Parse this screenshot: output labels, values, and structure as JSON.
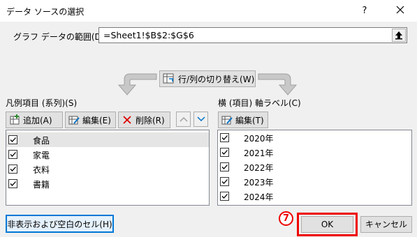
{
  "window": {
    "title": "データ ソースの選択",
    "help_glyph": "?",
    "close_glyph": "✕"
  },
  "range": {
    "label": "グラフ データの範囲(D):",
    "value": "=Sheet1!$B$2:$G$6"
  },
  "switch_button": {
    "label": "行/列の切り替え(W)"
  },
  "legend": {
    "label": "凡例項目 (系列)(S)",
    "add_label": "追加(A)",
    "edit_label": "編集(E)",
    "delete_label": "削除(R)",
    "items": [
      {
        "label": "食品",
        "checked": true,
        "selected": true
      },
      {
        "label": "家電",
        "checked": true,
        "selected": false
      },
      {
        "label": "衣料",
        "checked": true,
        "selected": false
      },
      {
        "label": "書籍",
        "checked": true,
        "selected": false
      }
    ]
  },
  "axis": {
    "label": "横 (項目) 軸ラベル(C)",
    "edit_label": "編集(T)",
    "items": [
      {
        "label": "2020年",
        "checked": true
      },
      {
        "label": "2021年",
        "checked": true
      },
      {
        "label": "2022年",
        "checked": true
      },
      {
        "label": "2023年",
        "checked": true
      },
      {
        "label": "2024年",
        "checked": true
      }
    ]
  },
  "footer": {
    "hidden_cells_label": "非表示および空白のセル(H)",
    "step_marker": "7",
    "ok_label": "OK",
    "cancel_label": "キャンセル"
  },
  "colors": {
    "highlight": "#e00000",
    "focus": "#0078d7",
    "accent_arrow": "#0072c6"
  }
}
